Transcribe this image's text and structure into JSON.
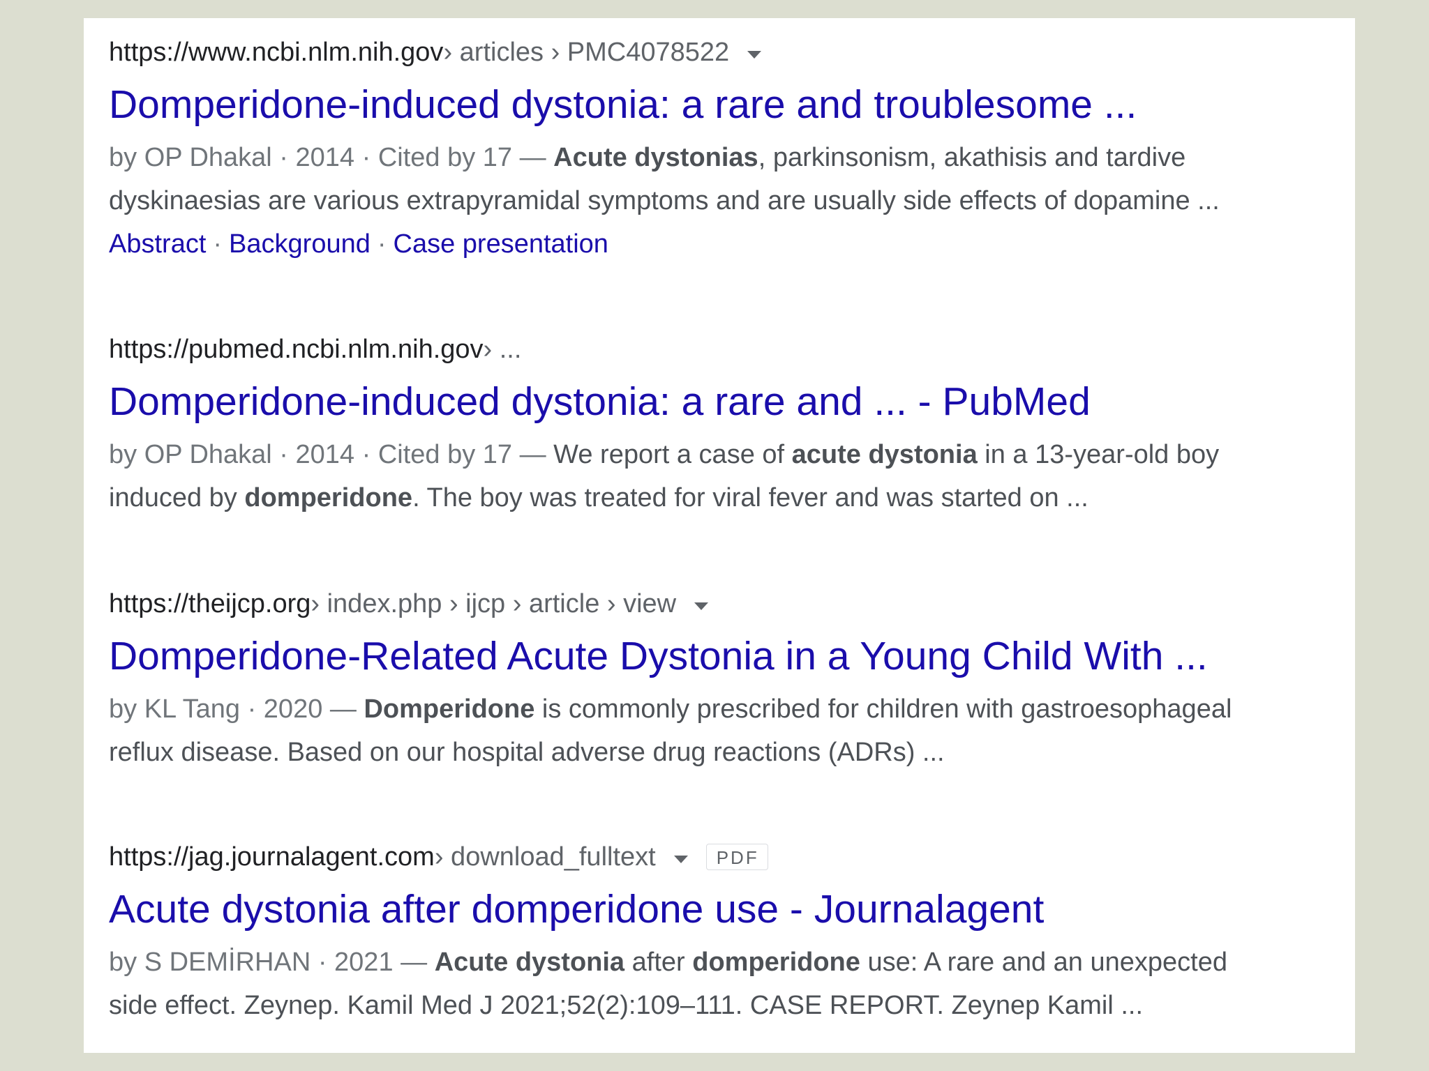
{
  "results": [
    {
      "host": "https://www.ncbi.nlm.nih.gov",
      "path": " › articles › PMC4078522",
      "title": "Domperidone-induced dystonia: a rare and troublesome ...",
      "meta": "by OP Dhakal · 2014 · Cited by 17 — ",
      "line1_bold": "Acute dystonias",
      "line1_rest": ", parkinsonism, akathisis and tardive",
      "line2": "dyskinaesias are various extrapyramidal symptoms and are usually side effects of dopamine ...",
      "sitelinks": [
        "Abstract",
        "Background",
        "Case presentation"
      ]
    },
    {
      "host": "https://pubmed.ncbi.nlm.nih.gov",
      "path": " › ...",
      "title": "Domperidone-induced dystonia: a rare and ... - PubMed",
      "meta": "by OP Dhakal · 2014 · Cited by 17 — ",
      "line1_a": "We report a case of ",
      "line1_bold": "acute dystonia",
      "line1_b": " in a 13-year-old boy",
      "line2_a": "induced by ",
      "line2_bold": "domperidone",
      "line2_b": ". The boy was treated for viral fever and was started on ..."
    },
    {
      "host": "https://theijcp.org",
      "path": " › index.php › ijcp › article › view",
      "title": "Domperidone-Related Acute Dystonia in a Young Child With ...",
      "meta": "by KL Tang · 2020 — ",
      "line1_bold": "Domperidone",
      "line1_rest": " is commonly prescribed for children with gastroesophageal",
      "line2": "reflux disease. Based on our hospital adverse drug reactions (ADRs) ..."
    },
    {
      "host": "https://jag.journalagent.com",
      "path": " › download_fulltext",
      "badge": "PDF",
      "title": "Acute dystonia after domperidone use - Journalagent",
      "meta": "by S DEMİRHAN · 2021 — ",
      "line1_bold_a": "Acute dystonia",
      "line1_mid": " after ",
      "line1_bold_b": "domperidone",
      "line1_rest": " use: A rare and an unexpected",
      "line2": "side effect. Zeynep. Kamil Med J 2021;52(2):109–111. CASE REPORT. Zeynep Kamil ..."
    }
  ]
}
